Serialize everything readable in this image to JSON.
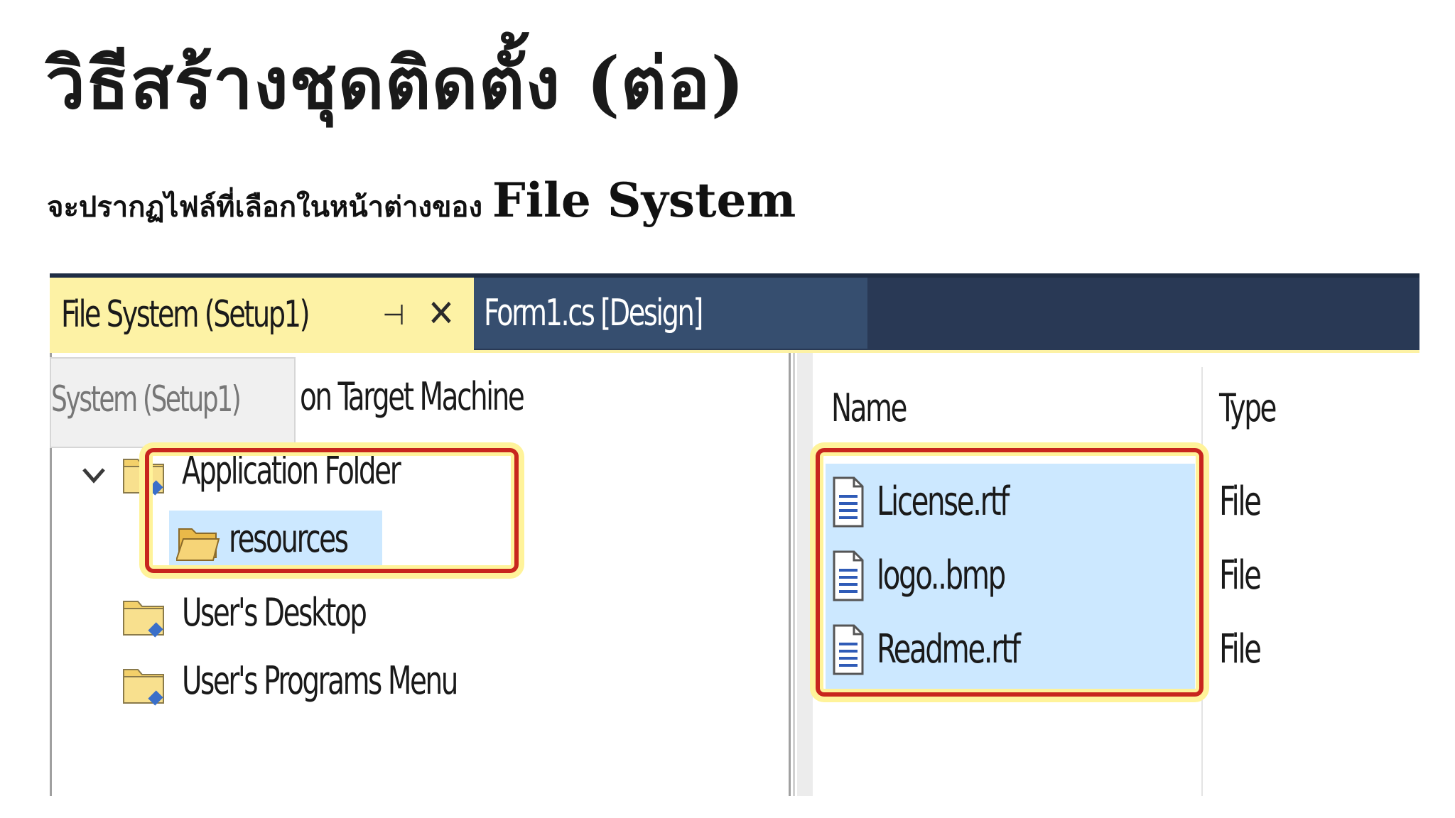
{
  "slide": {
    "title": "วิธีสร้างชุดติดตั้ง (ต่อ)",
    "subtitle_thai": "จะปรากฏไฟล์ที่เลือกในหน้าต่างของ ",
    "subtitle_latin": "File System"
  },
  "ide": {
    "tabs": [
      {
        "label": "File System (Setup1)",
        "active": true
      },
      {
        "label": "Form1.cs [Design]",
        "active": false
      }
    ],
    "tab_icons": {
      "pin": "pin-icon",
      "close": "close-icon"
    },
    "tooltip_ghost": "System (Setup1)",
    "tree": {
      "root_label": "on Target Machine",
      "nodes": [
        {
          "label": "Application Folder",
          "expanded": true,
          "icon": "folder-icon"
        },
        {
          "label": "resources",
          "selected": true,
          "icon": "open-folder-icon"
        },
        {
          "label": "User's Desktop",
          "icon": "folder-icon"
        },
        {
          "label": "User's Programs Menu",
          "icon": "folder-icon"
        }
      ]
    },
    "file_list": {
      "columns": [
        "Name",
        "Type"
      ],
      "rows": [
        {
          "name": "License.rtf",
          "type": "File",
          "icon": "document-icon"
        },
        {
          "name": "logo..bmp",
          "type": "File",
          "icon": "document-icon"
        },
        {
          "name": "Readme.rtf",
          "type": "File",
          "icon": "document-icon"
        }
      ]
    },
    "colors": {
      "tab_strip": "#293955",
      "active_tab": "#fdf2a5",
      "selection": "#cce8ff",
      "highlight_border": "#c8261d",
      "highlight_glow": "#fff39a"
    }
  }
}
